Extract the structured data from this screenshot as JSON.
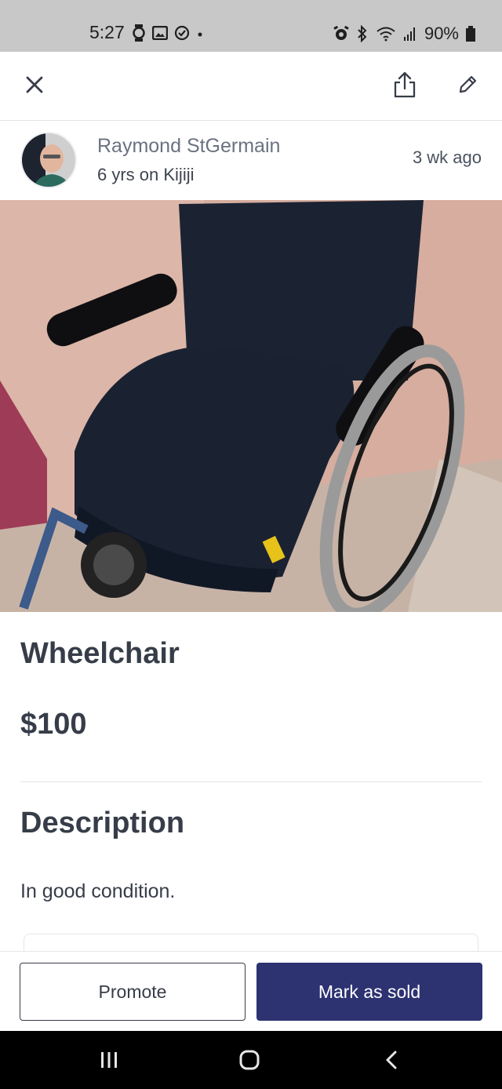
{
  "status_bar": {
    "time": "5:27",
    "battery": "90%",
    "left_icons": [
      "watch-icon",
      "gallery-icon",
      "check-circle-icon",
      "dot-icon"
    ],
    "right_icons": [
      "alarm-icon",
      "bluetooth-icon",
      "wifi-icon",
      "signal-icon",
      "battery-icon"
    ]
  },
  "toolbar": {
    "close_icon": "close-icon",
    "share_icon": "share-icon",
    "edit_icon": "pencil-icon"
  },
  "seller": {
    "name": "Raymond StGermain",
    "tenure": "6 yrs on Kijiji",
    "posted": "3 wk  ago"
  },
  "listing": {
    "title": "Wheelchair",
    "price": "$100",
    "description_heading": "Description",
    "description": "In good condition."
  },
  "actions": {
    "promote_label": "Promote",
    "mark_sold_label": "Mark as sold"
  },
  "colors": {
    "primary": "#2d3271",
    "text": "#373d48",
    "status_bar": "#c8c8c8"
  },
  "nav_bar": {
    "icons": [
      "recents-icon",
      "home-icon",
      "back-icon"
    ]
  }
}
